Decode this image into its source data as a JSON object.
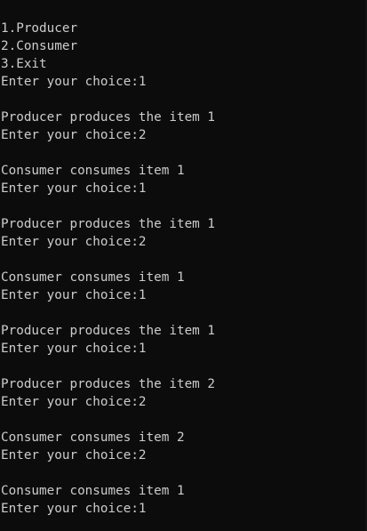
{
  "console": {
    "lines": [
      "1.Producer",
      "2.Consumer",
      "3.Exit",
      "Enter your choice:1",
      "",
      "Producer produces the item 1",
      "Enter your choice:2",
      "",
      "Consumer consumes item 1",
      "Enter your choice:1",
      "",
      "Producer produces the item 1",
      "Enter your choice:2",
      "",
      "Consumer consumes item 1",
      "Enter your choice:1",
      "",
      "Producer produces the item 1",
      "Enter your choice:1",
      "",
      "Producer produces the item 2",
      "Enter your choice:2",
      "",
      "Consumer consumes item 2",
      "Enter your choice:2",
      "",
      "Consumer consumes item 1",
      "Enter your choice:1"
    ]
  },
  "colors": {
    "background": "#0c0c0c",
    "text": "#cccccc"
  }
}
